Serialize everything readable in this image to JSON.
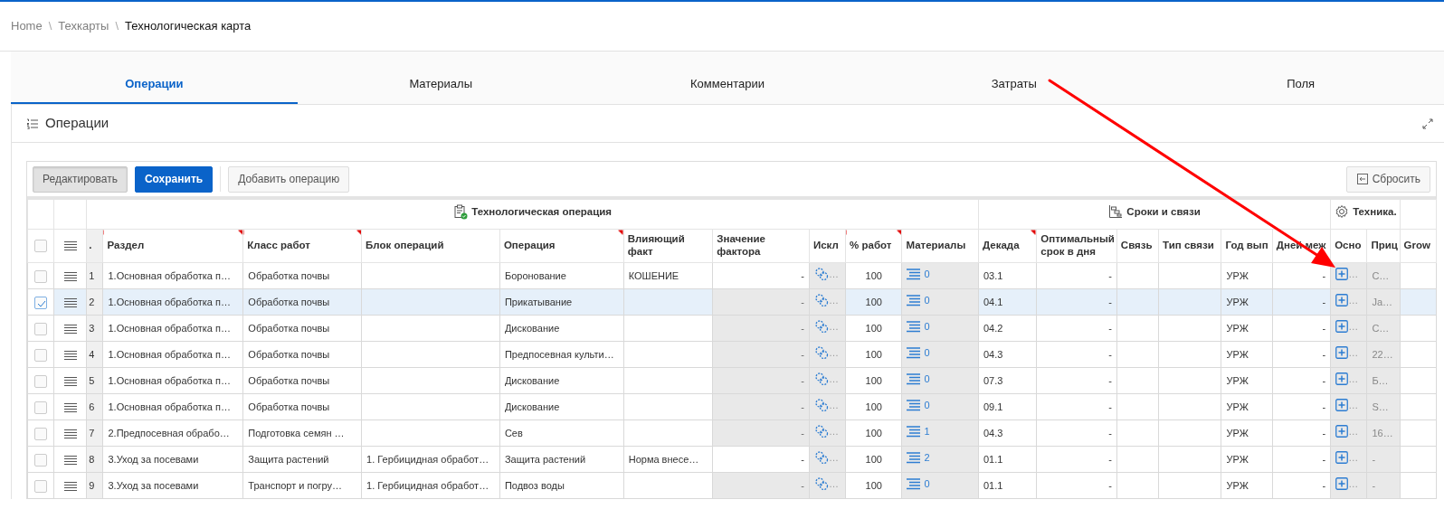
{
  "breadcrumb": [
    {
      "kind": "link",
      "label": "Home",
      "current": false
    },
    {
      "kind": "separator",
      "label": "\\"
    },
    {
      "kind": "link",
      "label": "Техкарты",
      "current": false
    },
    {
      "kind": "separator",
      "label": "\\"
    },
    {
      "kind": "link",
      "label": "Технологическая карта",
      "current": true
    }
  ],
  "tabs": [
    {
      "label": "Операции",
      "selected": true
    },
    {
      "label": "Материалы",
      "selected": false
    },
    {
      "label": "Комментарии",
      "selected": false
    },
    {
      "label": "Затраты",
      "selected": false
    },
    {
      "label": "Поля",
      "selected": false
    }
  ],
  "panel": {
    "title": "Операции"
  },
  "toolbar": {
    "buttons": [
      {
        "label": "Редактировать",
        "kind": "secondary",
        "active": true
      },
      {
        "label": "Сохранить",
        "kind": "primary",
        "active": false
      },
      {
        "label": "Добавить операцию",
        "kind": "default",
        "active": false
      }
    ],
    "reset_button": {
      "label": "Сбросить"
    }
  },
  "grid": {
    "row_number_header": ".",
    "header_checked": false,
    "groups": [
      {
        "label": "Технологическая операция",
        "columns": [
          {
            "label": "Раздел",
            "required": true,
            "kind": "editable"
          },
          {
            "label": "Класс работ",
            "required": true,
            "kind": "editable"
          },
          {
            "label": "Блок операций",
            "required": false,
            "kind": "editable"
          },
          {
            "label": "Операция",
            "required": true,
            "kind": "editable"
          },
          {
            "label": "Влияющий факт",
            "required": false,
            "kind": "editable"
          },
          {
            "label": "Значение фактора",
            "required": false,
            "kind": "editable"
          },
          {
            "label": "Искл",
            "required": false,
            "kind": "readonly"
          },
          {
            "label": "% работ",
            "required": true,
            "kind": "editable"
          },
          {
            "label": "Материалы",
            "required": false,
            "kind": "readonly"
          }
        ]
      },
      {
        "label": "Сроки и связи",
        "columns": [
          {
            "label": "Декада",
            "required": true,
            "kind": "editable"
          },
          {
            "label": "Оптимальный срок в дня",
            "required": false,
            "kind": "editable"
          },
          {
            "label": "Связь",
            "required": false,
            "kind": "editable"
          },
          {
            "label": "Тип связи",
            "required": false,
            "kind": "editable"
          },
          {
            "label": "Год вып",
            "required": false,
            "kind": "editable"
          },
          {
            "label": "Дней меж",
            "required": false,
            "kind": "editable"
          }
        ]
      },
      {
        "label": "Техника.",
        "columns": [
          {
            "label": "Осно",
            "required": false,
            "kind": "readonly"
          },
          {
            "label": "Приц",
            "required": false,
            "kind": "readonly"
          }
        ]
      },
      {
        "columns": [
          {
            "label": "Grow",
            "required": false,
            "kind": "editable"
          }
        ]
      }
    ],
    "rows": [
      {
        "selected": false,
        "number": "1",
        "factor_locked": false,
        "cells": [
          "1.Основная обработка п…",
          "Обработка почвы",
          "",
          "Боронование",
          "КОШЕНИЕ",
          "-",
          "…",
          "100",
          "0",
          "03.1",
          "-",
          "",
          "",
          "УРЖ",
          "-",
          "…",
          "С…",
          ""
        ]
      },
      {
        "selected": true,
        "number": "2",
        "factor_locked": true,
        "cells": [
          "1.Основная обработка п…",
          "Обработка почвы",
          "",
          "Прикатывание",
          "",
          "-",
          "…",
          "100",
          "0",
          "04.1",
          "-",
          "",
          "",
          "УРЖ",
          "-",
          "…",
          "Ja…",
          ""
        ]
      },
      {
        "selected": false,
        "number": "3",
        "factor_locked": true,
        "cells": [
          "1.Основная обработка п…",
          "Обработка почвы",
          "",
          "Дискование",
          "",
          "-",
          "…",
          "100",
          "0",
          "04.2",
          "-",
          "",
          "",
          "УРЖ",
          "-",
          "…",
          "С…",
          ""
        ]
      },
      {
        "selected": false,
        "number": "4",
        "factor_locked": true,
        "cells": [
          "1.Основная обработка п…",
          "Обработка почвы",
          "",
          "Предпосевная культи…",
          "",
          "-",
          "…",
          "100",
          "0",
          "04.3",
          "-",
          "",
          "",
          "УРЖ",
          "-",
          "…",
          "22…",
          ""
        ]
      },
      {
        "selected": false,
        "number": "5",
        "factor_locked": true,
        "cells": [
          "1.Основная обработка п…",
          "Обработка почвы",
          "",
          "Дискование",
          "",
          "-",
          "…",
          "100",
          "0",
          "07.3",
          "-",
          "",
          "",
          "УРЖ",
          "-",
          "…",
          "Б…",
          ""
        ]
      },
      {
        "selected": false,
        "number": "6",
        "factor_locked": true,
        "cells": [
          "1.Основная обработка п…",
          "Обработка почвы",
          "",
          "Дискование",
          "",
          "-",
          "…",
          "100",
          "0",
          "09.1",
          "-",
          "",
          "",
          "УРЖ",
          "-",
          "…",
          "S…",
          ""
        ]
      },
      {
        "selected": false,
        "number": "7",
        "factor_locked": true,
        "cells": [
          "2.Предпосевная обрабо…",
          "Подготовка семян …",
          "",
          "Сев",
          "",
          "-",
          "…",
          "100",
          "1",
          "04.3",
          "-",
          "",
          "",
          "УРЖ",
          "-",
          "…",
          "16…",
          ""
        ]
      },
      {
        "selected": false,
        "number": "8",
        "factor_locked": false,
        "cells": [
          "3.Уход за посевами",
          "Защита растений",
          "1. Гербицидная обработ…",
          "Защита растений",
          "Норма внесе…",
          "-",
          "…",
          "100",
          "2",
          "01.1",
          "-",
          "",
          "",
          "УРЖ",
          "-",
          "…",
          "-",
          ""
        ]
      },
      {
        "selected": false,
        "number": "9",
        "factor_locked": true,
        "cells": [
          "3.Уход за посевами",
          "Транспорт и погру…",
          "1. Гербицидная обработ…",
          "Подвоз воды",
          "",
          "-",
          "…",
          "100",
          "0",
          "01.1",
          "-",
          "",
          "",
          "УРЖ",
          "-",
          "…",
          "-",
          ""
        ]
      }
    ]
  },
  "annotation": {
    "kind": "arrow"
  }
}
